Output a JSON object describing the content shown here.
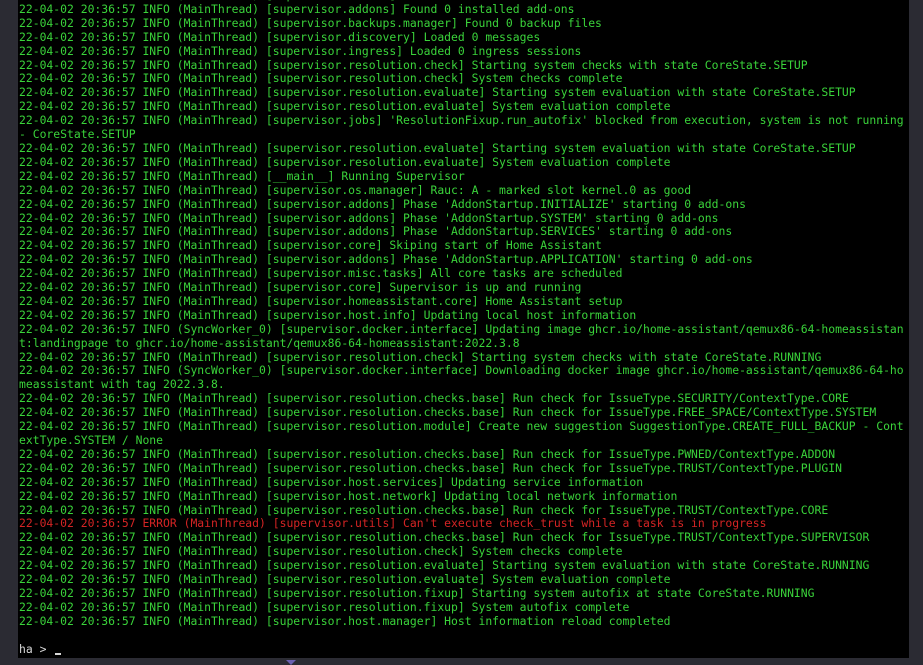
{
  "terminal": {
    "lines": [
      {
        "level": "info",
        "text": "22-04-02 20:36:57 INFO (MainThread) [supervisor.addons] Found 0 installed add-ons"
      },
      {
        "level": "info",
        "text": "22-04-02 20:36:57 INFO (MainThread) [supervisor.addons] Found 0 installed add-ons"
      },
      {
        "level": "info",
        "text": "22-04-02 20:36:57 INFO (MainThread) [supervisor.backups.manager] Found 0 backup files"
      },
      {
        "level": "info",
        "text": "22-04-02 20:36:57 INFO (MainThread) [supervisor.discovery] Loaded 0 messages"
      },
      {
        "level": "info",
        "text": "22-04-02 20:36:57 INFO (MainThread) [supervisor.ingress] Loaded 0 ingress sessions"
      },
      {
        "level": "info",
        "text": "22-04-02 20:36:57 INFO (MainThread) [supervisor.resolution.check] Starting system checks with state CoreState.SETUP"
      },
      {
        "level": "info",
        "text": "22-04-02 20:36:57 INFO (MainThread) [supervisor.resolution.check] System checks complete"
      },
      {
        "level": "info",
        "text": "22-04-02 20:36:57 INFO (MainThread) [supervisor.resolution.evaluate] Starting system evaluation with state CoreState.SETUP"
      },
      {
        "level": "info",
        "text": "22-04-02 20:36:57 INFO (MainThread) [supervisor.resolution.evaluate] System evaluation complete"
      },
      {
        "level": "info",
        "text": "22-04-02 20:36:57 INFO (MainThread) [supervisor.jobs] 'ResolutionFixup.run_autofix' blocked from execution, system is not running - CoreState.SETUP"
      },
      {
        "level": "info",
        "text": "22-04-02 20:36:57 INFO (MainThread) [supervisor.resolution.evaluate] Starting system evaluation with state CoreState.SETUP"
      },
      {
        "level": "info",
        "text": "22-04-02 20:36:57 INFO (MainThread) [supervisor.resolution.evaluate] System evaluation complete"
      },
      {
        "level": "info",
        "text": "22-04-02 20:36:57 INFO (MainThread) [__main__] Running Supervisor"
      },
      {
        "level": "info",
        "text": "22-04-02 20:36:57 INFO (MainThread) [supervisor.os.manager] Rauc: A - marked slot kernel.0 as good"
      },
      {
        "level": "info",
        "text": "22-04-02 20:36:57 INFO (MainThread) [supervisor.addons] Phase 'AddonStartup.INITIALIZE' starting 0 add-ons"
      },
      {
        "level": "info",
        "text": "22-04-02 20:36:57 INFO (MainThread) [supervisor.addons] Phase 'AddonStartup.SYSTEM' starting 0 add-ons"
      },
      {
        "level": "info",
        "text": "22-04-02 20:36:57 INFO (MainThread) [supervisor.addons] Phase 'AddonStartup.SERVICES' starting 0 add-ons"
      },
      {
        "level": "info",
        "text": "22-04-02 20:36:57 INFO (MainThread) [supervisor.core] Skiping start of Home Assistant"
      },
      {
        "level": "info",
        "text": "22-04-02 20:36:57 INFO (MainThread) [supervisor.addons] Phase 'AddonStartup.APPLICATION' starting 0 add-ons"
      },
      {
        "level": "info",
        "text": "22-04-02 20:36:57 INFO (MainThread) [supervisor.misc.tasks] All core tasks are scheduled"
      },
      {
        "level": "info",
        "text": "22-04-02 20:36:57 INFO (MainThread) [supervisor.core] Supervisor is up and running"
      },
      {
        "level": "info",
        "text": "22-04-02 20:36:57 INFO (MainThread) [supervisor.homeassistant.core] Home Assistant setup"
      },
      {
        "level": "info",
        "text": "22-04-02 20:36:57 INFO (MainThread) [supervisor.host.info] Updating local host information"
      },
      {
        "level": "info",
        "text": "22-04-02 20:36:57 INFO (SyncWorker_0) [supervisor.docker.interface] Updating image ghcr.io/home-assistant/qemux86-64-homeassistant:landingpage to ghcr.io/home-assistant/qemux86-64-homeassistant:2022.3.8"
      },
      {
        "level": "info",
        "text": "22-04-02 20:36:57 INFO (MainThread) [supervisor.resolution.check] Starting system checks with state CoreState.RUNNING"
      },
      {
        "level": "info",
        "text": "22-04-02 20:36:57 INFO (SyncWorker_0) [supervisor.docker.interface] Downloading docker image ghcr.io/home-assistant/qemux86-64-homeassistant with tag 2022.3.8."
      },
      {
        "level": "info",
        "text": "22-04-02 20:36:57 INFO (MainThread) [supervisor.resolution.checks.base] Run check for IssueType.SECURITY/ContextType.CORE"
      },
      {
        "level": "info",
        "text": "22-04-02 20:36:57 INFO (MainThread) [supervisor.resolution.checks.base] Run check for IssueType.FREE_SPACE/ContextType.SYSTEM"
      },
      {
        "level": "info",
        "text": "22-04-02 20:36:57 INFO (MainThread) [supervisor.resolution.module] Create new suggestion SuggestionType.CREATE_FULL_BACKUP - ContextType.SYSTEM / None"
      },
      {
        "level": "info",
        "text": "22-04-02 20:36:57 INFO (MainThread) [supervisor.resolution.checks.base] Run check for IssueType.PWNED/ContextType.ADDON"
      },
      {
        "level": "info",
        "text": "22-04-02 20:36:57 INFO (MainThread) [supervisor.resolution.checks.base] Run check for IssueType.TRUST/ContextType.PLUGIN"
      },
      {
        "level": "info",
        "text": "22-04-02 20:36:57 INFO (MainThread) [supervisor.host.services] Updating service information"
      },
      {
        "level": "info",
        "text": "22-04-02 20:36:57 INFO (MainThread) [supervisor.host.network] Updating local network information"
      },
      {
        "level": "info",
        "text": "22-04-02 20:36:57 INFO (MainThread) [supervisor.resolution.checks.base] Run check for IssueType.TRUST/ContextType.CORE"
      },
      {
        "level": "error",
        "text": "22-04-02 20:36:57 ERROR (MainThread) [supervisor.utils] Can't execute check_trust while a task is in progress"
      },
      {
        "level": "info",
        "text": "22-04-02 20:36:57 INFO (MainThread) [supervisor.resolution.checks.base] Run check for IssueType.TRUST/ContextType.SUPERVISOR"
      },
      {
        "level": "info",
        "text": "22-04-02 20:36:57 INFO (MainThread) [supervisor.resolution.check] System checks complete"
      },
      {
        "level": "info",
        "text": "22-04-02 20:36:57 INFO (MainThread) [supervisor.resolution.evaluate] Starting system evaluation with state CoreState.RUNNING"
      },
      {
        "level": "info",
        "text": "22-04-02 20:36:57 INFO (MainThread) [supervisor.resolution.evaluate] System evaluation complete"
      },
      {
        "level": "info",
        "text": "22-04-02 20:36:57 INFO (MainThread) [supervisor.resolution.fixup] Starting system autofix at state CoreState.RUNNING"
      },
      {
        "level": "info",
        "text": "22-04-02 20:36:57 INFO (MainThread) [supervisor.resolution.fixup] System autofix complete"
      },
      {
        "level": "info",
        "text": "22-04-02 20:36:57 INFO (MainThread) [supervisor.host.manager] Host information reload completed"
      }
    ],
    "prompt": "ha > "
  },
  "colors": {
    "info": "#3ad33a",
    "error": "#d42424",
    "background": "#000000",
    "frame": "#2b2b33"
  }
}
